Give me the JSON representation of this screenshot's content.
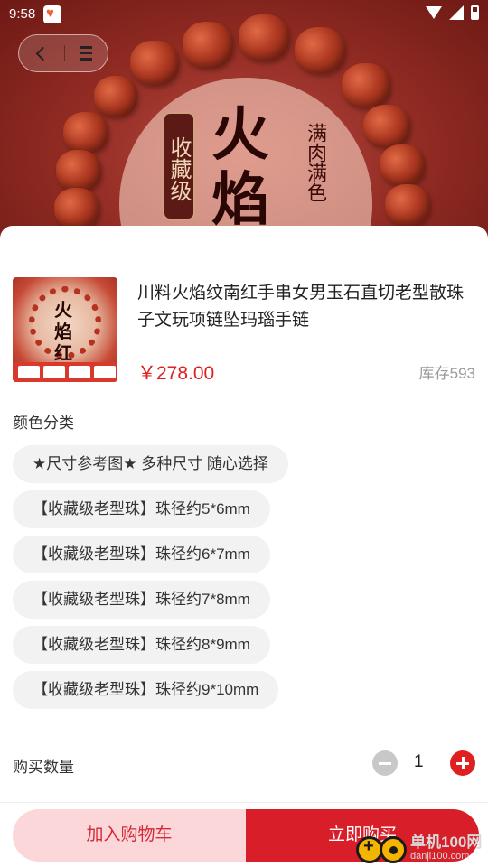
{
  "status_bar": {
    "time": "9:58"
  },
  "hero": {
    "plaque_text": "收藏级",
    "big_chars": [
      "火",
      "焰"
    ],
    "side_text": "满肉满色"
  },
  "icons": {
    "back": "chevron-left-icon",
    "menu": "menu-icon",
    "wifi": "wifi-icon",
    "signal": "signal-icon",
    "battery": "battery-icon"
  },
  "product": {
    "title": "川料火焰纹南红手串女男玉石直切老型散珠子文玩项链坠玛瑙手链",
    "price": "￥278.00",
    "stock": "库存593",
    "thumb_text": "火焰红"
  },
  "variants": {
    "label": "颜色分类",
    "options": [
      "★尺寸参考图★ 多种尺寸 随心选择",
      "【收藏级老型珠】珠径约5*6mm",
      "【收藏级老型珠】珠径约6*7mm",
      "【收藏级老型珠】珠径约7*8mm",
      "【收藏级老型珠】珠径约8*9mm",
      "【收藏级老型珠】珠径约9*10mm"
    ]
  },
  "quantity": {
    "label": "购买数量",
    "value": "1"
  },
  "actions": {
    "add_to_cart": "加入购物车",
    "buy_now": "立即购买"
  },
  "watermark": {
    "name": "单机100网",
    "url": "danji100.com"
  },
  "colors": {
    "accent": "#d81e28",
    "price": "#e02020",
    "cart_bg": "#fbd7da",
    "chip_bg": "#f2f2f2"
  }
}
